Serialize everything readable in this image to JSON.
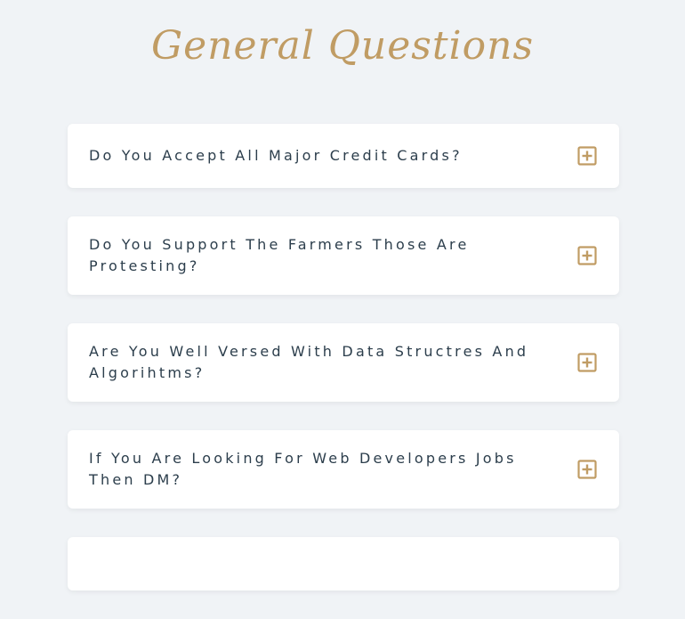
{
  "page": {
    "title": "General Questions"
  },
  "colors": {
    "accent": "#c09c64",
    "background": "#f0f3f6",
    "card": "#ffffff",
    "text": "#2c3e4c"
  },
  "faq": {
    "items": [
      {
        "question": "Do You Accept All Major Credit Cards?",
        "icon": "plus-square-icon"
      },
      {
        "question": "Do You Support The Farmers Those Are Protesting?",
        "icon": "plus-square-icon"
      },
      {
        "question": "Are You Well Versed With Data Structres And Algorihtms?",
        "icon": "plus-square-icon"
      },
      {
        "question": "If You Are Looking For Web Developers Jobs Then DM?",
        "icon": "plus-square-icon"
      }
    ]
  }
}
